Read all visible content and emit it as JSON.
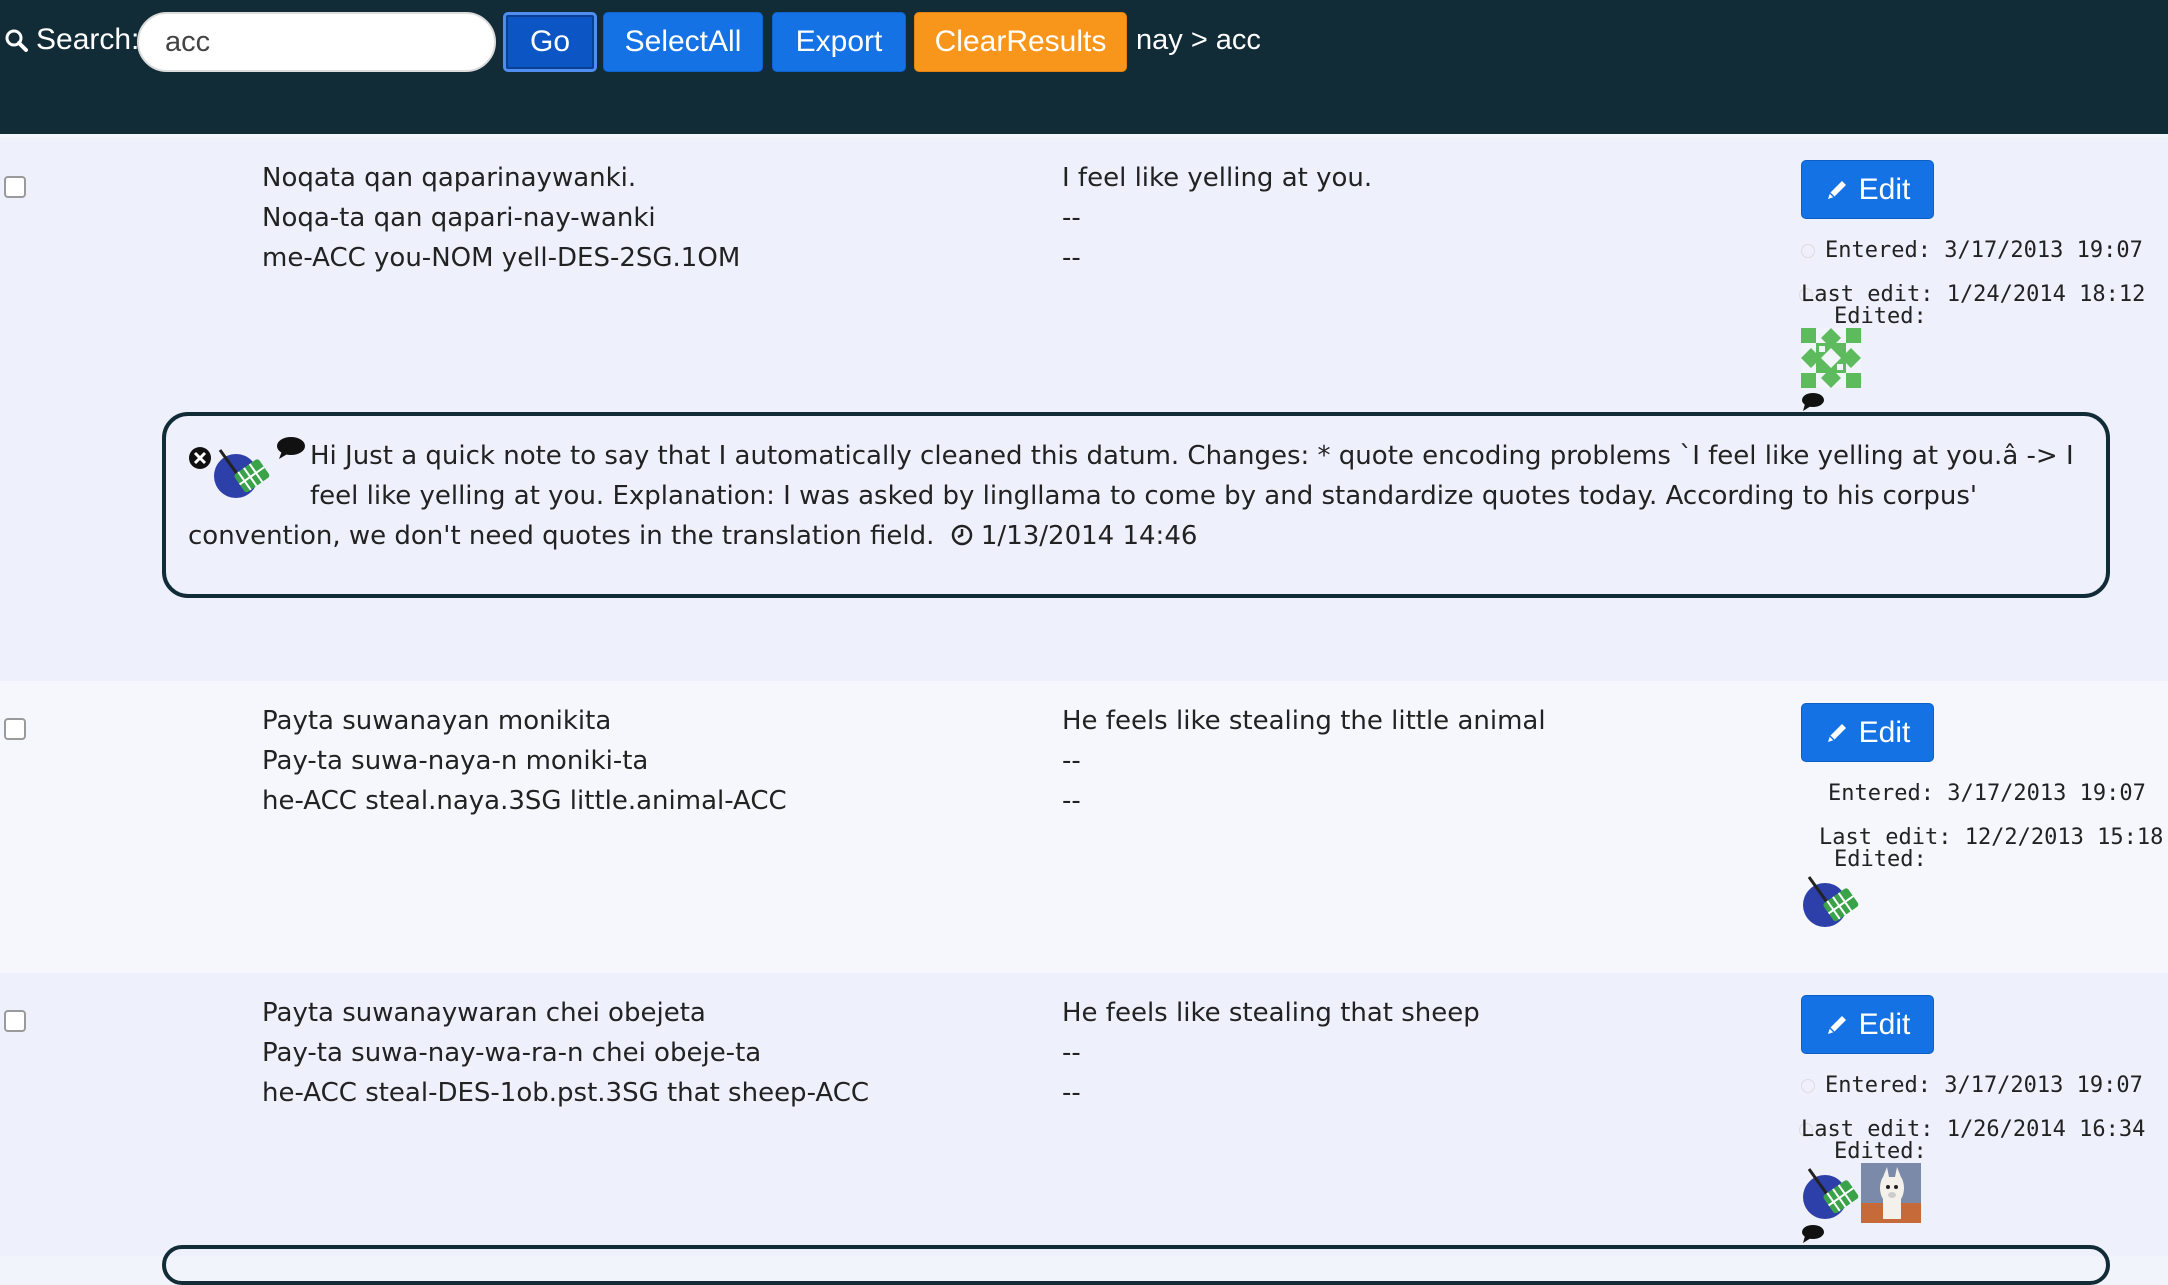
{
  "search": {
    "label": "Search:",
    "value": "acc",
    "go": "Go",
    "select_all": "SelectAll",
    "export": "Export",
    "clear": "ClearResults",
    "breadcrumb": "nay > acc"
  },
  "rows": [
    {
      "utterance": "Noqata qan qaparinaywanki.",
      "morphemes": "Noqa-ta qan qapari-nay-wanki",
      "gloss": "me-ACC you-NOM yell-DES-2SG.1OM",
      "translation": "I feel like yelling at you.",
      "trans2": "--",
      "trans3": "--",
      "edit": "Edit",
      "entered": "Entered: 3/17/2013 19:07",
      "last_edit": "Last edit: 1/24/2014 18:12",
      "edited": "Edited:",
      "comment": {
        "text": "Hi Just a quick note to say that I automatically cleaned this datum. Changes: * quote encoding problems `I feel like yelling at you.â -> I feel like yelling at you. Explanation: I was asked by lingllama to come by and standardize quotes today. According to his corpus' convention, we don't need quotes in the translation field.",
        "timestamp": "1/13/2014 14:46"
      }
    },
    {
      "utterance": "Payta suwanayan monikita",
      "morphemes": "Pay-ta suwa-naya-n moniki-ta",
      "gloss": "he-ACC steal.naya.3SG little.animal-ACC",
      "translation": "He feels like stealing the little animal",
      "trans2": "--",
      "trans3": "--",
      "edit": "Edit",
      "entered": "Entered: 3/17/2013 19:07",
      "last_edit": "Last edit: 12/2/2013 15:18",
      "edited": "Edited:"
    },
    {
      "utterance": "Payta suwanaywaran chei obejeta",
      "morphemes": "Pay-ta suwa-nay-wa-ra-n chei obeje-ta",
      "gloss": "he-ACC steal-DES-1ob.pst.3SG that sheep-ACC",
      "translation": "He feels like stealing that sheep",
      "trans2": "--",
      "trans3": "--",
      "edit": "Edit",
      "entered": "Entered: 3/17/2013 19:07",
      "last_edit": "Last edit: 1/26/2014 16:34",
      "edited": "Edited:"
    }
  ],
  "icons": {
    "search": "search-icon",
    "pencil": "pencil-icon",
    "clock": "clock-icon",
    "close": "close-icon",
    "comment": "speech-bubble-icon"
  },
  "colors": {
    "topbar": "#112b37",
    "primary": "#1472e5",
    "warning": "#f8961b"
  }
}
